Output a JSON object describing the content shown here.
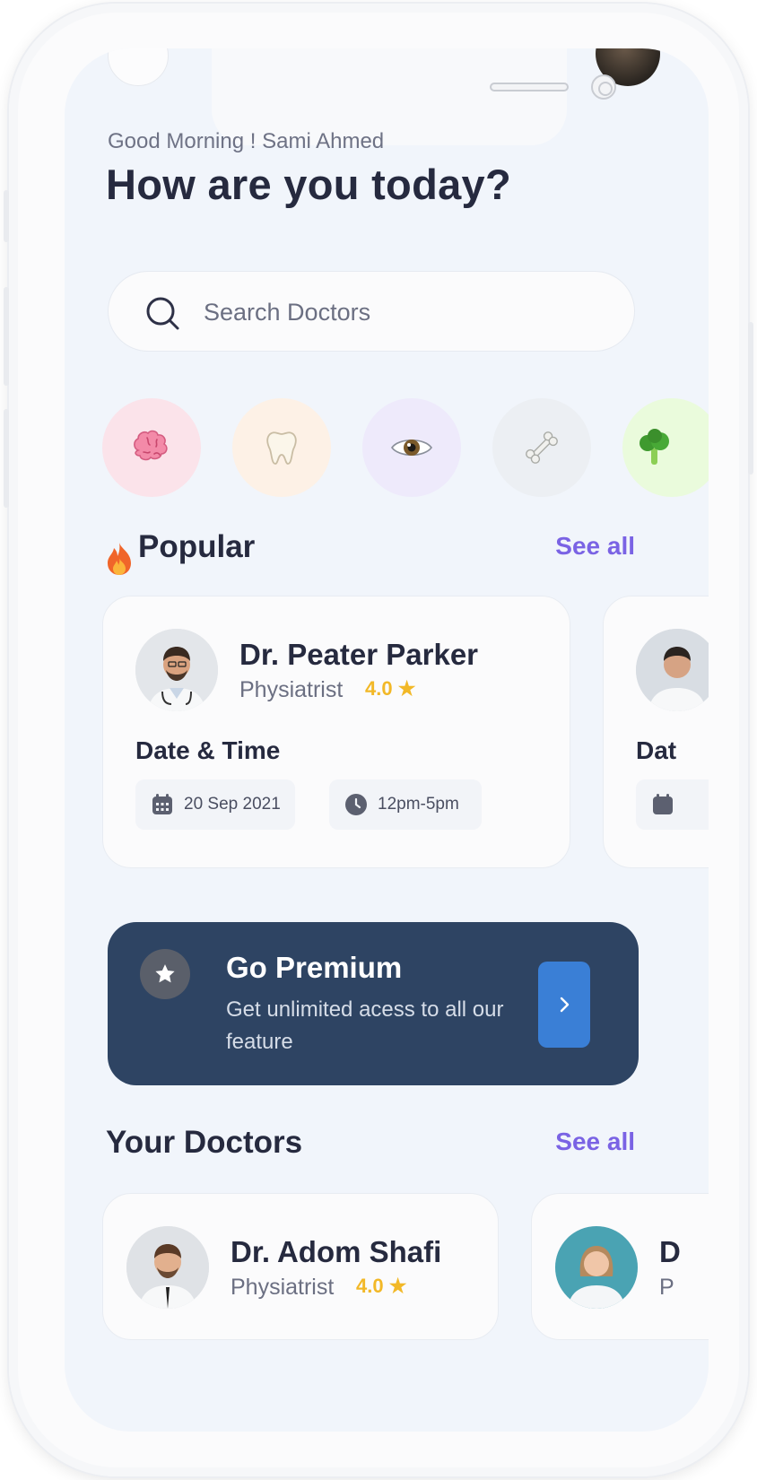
{
  "header": {
    "greeting": "Good Morning ! Sami Ahmed",
    "title": "How are you today?"
  },
  "search": {
    "placeholder": "Search Doctors",
    "value": ""
  },
  "categories": [
    {
      "icon": "brain-icon",
      "color": "#fbe3ea"
    },
    {
      "icon": "tooth-icon",
      "color": "#fdf1e6"
    },
    {
      "icon": "eye-icon",
      "color": "#eeeafb"
    },
    {
      "icon": "bone-icon",
      "color": "#eceff3"
    },
    {
      "icon": "broccoli-icon",
      "color": "#eafbdc"
    }
  ],
  "popular": {
    "title": "Popular",
    "see_all": "See all",
    "cards": [
      {
        "name": "Dr. Peater Parker",
        "specialty": "Physiatrist",
        "rating": "4.0",
        "date_time_label": "Date & Time",
        "date": "20 Sep 2021",
        "time": "12pm-5pm"
      },
      {
        "name": "",
        "specialty": "",
        "rating": "",
        "date_time_label": "Dat",
        "date": "",
        "time": ""
      }
    ]
  },
  "premium": {
    "title": "Go Premium",
    "subtitle": "Get unlimited acess to all our feature"
  },
  "your_doctors": {
    "title": "Your Doctors",
    "see_all": "See all",
    "cards": [
      {
        "name": "Dr. Adom Shafi",
        "specialty": "Physiatrist",
        "rating": "4.0"
      },
      {
        "name": "D",
        "specialty": "P",
        "rating": ""
      }
    ]
  },
  "colors": {
    "accent": "#7a63e4",
    "rating": "#f2b827",
    "premium_bg": "#2e4463",
    "premium_button": "#3a7fd6",
    "screen_bg": "#f1f5fb"
  }
}
